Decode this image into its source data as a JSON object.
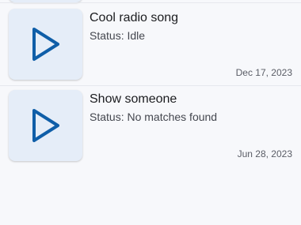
{
  "songs": [
    {
      "title": "Cool radio song",
      "status": "Status: Idle",
      "date": "Dec 17, 2023",
      "thumbnail_icon": "play-icon"
    },
    {
      "title": "Show someone",
      "status": "Status: No matches found",
      "date": "Jun 28, 2023",
      "thumbnail_icon": "play-icon"
    }
  ],
  "colors": {
    "background": "#f7f8fb",
    "thumbnail": "#e5edf8",
    "play_icon": "#0f5ea8",
    "divider": "#e6e8ee"
  }
}
